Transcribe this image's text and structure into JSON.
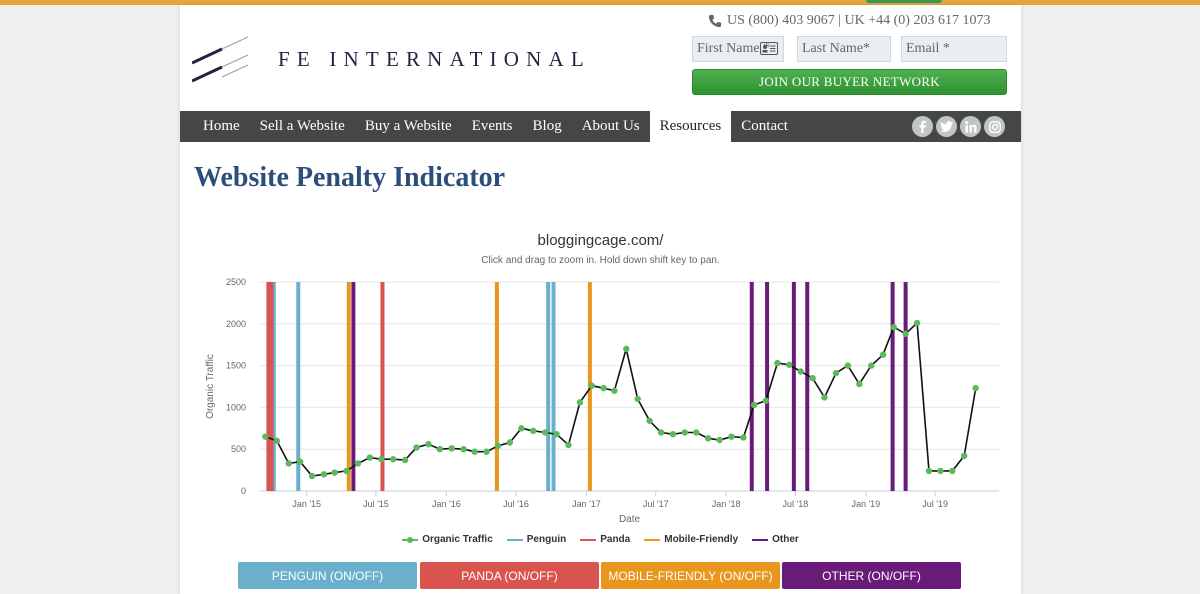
{
  "header": {
    "brand": "FE INTERNATIONAL",
    "phone": "US (800) 403 9067 | UK +44 (0) 203 617 1073",
    "first_name_placeholder": "First Name *",
    "last_name_placeholder": "Last Name*",
    "email_placeholder": "Email *",
    "join_label": "JOIN OUR BUYER NETWORK"
  },
  "nav": {
    "items": [
      "Home",
      "Sell a Website",
      "Buy a Website",
      "Events",
      "Blog",
      "About Us",
      "Resources",
      "Contact"
    ],
    "active": "Resources",
    "social_icons": [
      "facebook-icon",
      "twitter-icon",
      "linkedin-icon",
      "instagram-icon"
    ]
  },
  "page": {
    "title": "Website Penalty Indicator"
  },
  "buttons": {
    "penguin": "PENGUIN (ON/OFF)",
    "panda": "PANDA (ON/OFF)",
    "mobile": "MOBILE-FRIENDLY (ON/OFF)",
    "other": "OTHER (ON/OFF)"
  },
  "colors": {
    "accent_bar": "#e8a33d",
    "nav_bg": "#454747",
    "title": "#2d4d7c",
    "join": "#3a9a3e",
    "traffic_line": "#111111",
    "traffic_marker": "#5cb85c",
    "penguin": "#6ab0cc",
    "panda": "#d9534f",
    "mobile_friendly": "#e8961e",
    "other": "#6a1b7a"
  },
  "chart_data": {
    "type": "line",
    "title": "bloggingcage.com/",
    "subtitle": "Click and drag to zoom in. Hold down shift key to pan.",
    "xlabel": "Date",
    "ylabel": "Organic Traffic",
    "ylim": [
      0,
      2500
    ],
    "yticks": [
      0,
      500,
      1000,
      1500,
      2000,
      2500
    ],
    "xlim": [
      "2014-09-01",
      "2019-12-15"
    ],
    "xticks": [
      {
        "date": "2015-01-01",
        "label": "Jan '15"
      },
      {
        "date": "2015-07-01",
        "label": "Jul '15"
      },
      {
        "date": "2016-01-01",
        "label": "Jan '16"
      },
      {
        "date": "2016-07-01",
        "label": "Jul '16"
      },
      {
        "date": "2017-01-01",
        "label": "Jan '17"
      },
      {
        "date": "2017-07-01",
        "label": "Jul '17"
      },
      {
        "date": "2018-01-01",
        "label": "Jan '18"
      },
      {
        "date": "2018-07-01",
        "label": "Jul '18"
      },
      {
        "date": "2019-01-01",
        "label": "Jan '19"
      },
      {
        "date": "2019-07-01",
        "label": "Jul '19"
      }
    ],
    "grid": true,
    "legend_position": "bottom",
    "series": [
      {
        "name": "Organic Traffic",
        "points": [
          [
            "2014-09-15",
            650
          ],
          [
            "2014-10-15",
            600
          ],
          [
            "2014-11-15",
            330
          ],
          [
            "2014-12-15",
            350
          ],
          [
            "2015-01-15",
            180
          ],
          [
            "2015-02-15",
            200
          ],
          [
            "2015-03-15",
            220
          ],
          [
            "2015-04-15",
            240
          ],
          [
            "2015-05-15",
            330
          ],
          [
            "2015-06-15",
            400
          ],
          [
            "2015-07-15",
            380
          ],
          [
            "2015-08-15",
            380
          ],
          [
            "2015-09-15",
            370
          ],
          [
            "2015-10-15",
            520
          ],
          [
            "2015-11-15",
            560
          ],
          [
            "2015-12-15",
            500
          ],
          [
            "2016-01-15",
            510
          ],
          [
            "2016-02-15",
            500
          ],
          [
            "2016-03-15",
            470
          ],
          [
            "2016-04-15",
            470
          ],
          [
            "2016-05-15",
            540
          ],
          [
            "2016-06-15",
            580
          ],
          [
            "2016-07-15",
            750
          ],
          [
            "2016-08-15",
            720
          ],
          [
            "2016-09-15",
            700
          ],
          [
            "2016-10-15",
            680
          ],
          [
            "2016-11-15",
            550
          ],
          [
            "2016-12-15",
            1060
          ],
          [
            "2017-01-15",
            1260
          ],
          [
            "2017-02-15",
            1230
          ],
          [
            "2017-03-15",
            1200
          ],
          [
            "2017-04-15",
            1700
          ],
          [
            "2017-05-15",
            1100
          ],
          [
            "2017-06-15",
            840
          ],
          [
            "2017-07-15",
            700
          ],
          [
            "2017-08-15",
            680
          ],
          [
            "2017-09-15",
            700
          ],
          [
            "2017-10-15",
            700
          ],
          [
            "2017-11-15",
            630
          ],
          [
            "2017-12-15",
            610
          ],
          [
            "2018-01-15",
            650
          ],
          [
            "2018-02-15",
            640
          ],
          [
            "2018-03-15",
            1030
          ],
          [
            "2018-04-15",
            1080
          ],
          [
            "2018-05-15",
            1530
          ],
          [
            "2018-06-15",
            1510
          ],
          [
            "2018-07-15",
            1430
          ],
          [
            "2018-08-15",
            1350
          ],
          [
            "2018-09-15",
            1120
          ],
          [
            "2018-10-15",
            1410
          ],
          [
            "2018-11-15",
            1500
          ],
          [
            "2018-12-15",
            1280
          ],
          [
            "2019-01-15",
            1500
          ],
          [
            "2019-02-15",
            1630
          ],
          [
            "2019-03-15",
            1960
          ],
          [
            "2019-04-15",
            1880
          ],
          [
            "2019-05-15",
            2010
          ],
          [
            "2019-06-15",
            240
          ],
          [
            "2019-07-15",
            240
          ],
          [
            "2019-08-15",
            240
          ],
          [
            "2019-09-15",
            420
          ],
          [
            "2019-10-15",
            1230
          ]
        ]
      },
      {
        "name": "Penguin",
        "type": "vlines",
        "dates": [
          "2014-10-07",
          "2014-12-10",
          "2016-09-23",
          "2016-10-07"
        ]
      },
      {
        "name": "Panda",
        "type": "vlines",
        "dates": [
          "2014-09-23",
          "2014-10-01",
          "2015-07-18"
        ]
      },
      {
        "name": "Mobile-Friendly",
        "type": "vlines",
        "dates": [
          "2015-04-21",
          "2016-05-12",
          "2017-01-10"
        ]
      },
      {
        "name": "Other",
        "type": "vlines",
        "dates": [
          "2015-05-03",
          "2018-03-09",
          "2018-04-18",
          "2018-06-27",
          "2018-08-01",
          "2019-03-12",
          "2019-04-15"
        ]
      }
    ]
  }
}
